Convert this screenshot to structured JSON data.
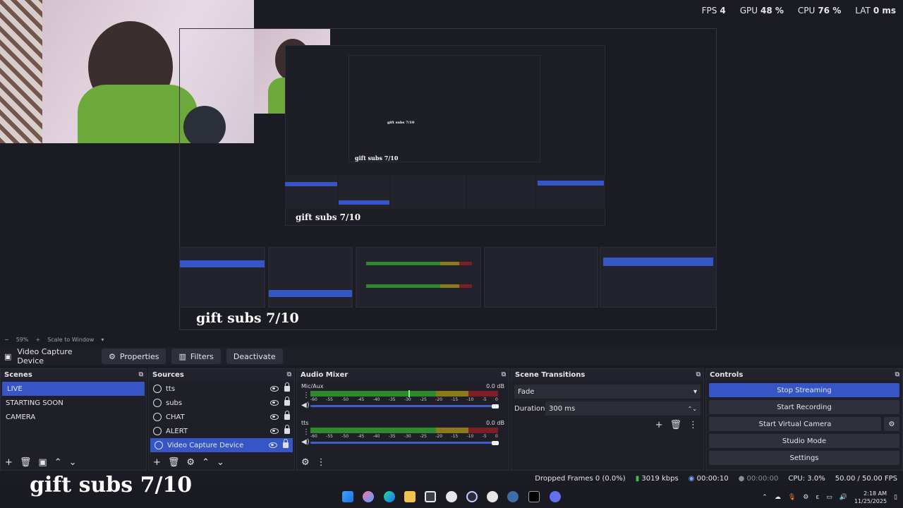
{
  "perf": {
    "fps_label": "FPS",
    "fps": "4",
    "gpu_label": "GPU",
    "gpu": "48 %",
    "cpu_label": "CPU",
    "cpu": "76 %",
    "lat_label": "LAT",
    "lat": "0 ms"
  },
  "preview": {
    "caption_lg": "gift subs 7/10",
    "caption_md": "gift subs 7/10",
    "caption_sm": "gift subs 7/10",
    "caption_xs": "gift subs 7/10"
  },
  "zoom": {
    "value": "59%",
    "label": "Scale to Window"
  },
  "context": {
    "title": "Video Capture Device",
    "properties": "Properties",
    "filters": "Filters",
    "deactivate": "Deactivate"
  },
  "scenes": {
    "title": "Scenes",
    "items": [
      "LIVE",
      "STARTING SOON",
      "CAMERA"
    ]
  },
  "sources": {
    "title": "Sources",
    "items": [
      "tts",
      "subs",
      "CHAT",
      "ALERT",
      "Video Capture Device"
    ]
  },
  "mixer": {
    "title": "Audio Mixer",
    "channels": [
      {
        "name": "Mic/Aux",
        "db": "0.0 dB"
      },
      {
        "name": "tts",
        "db": "0.0 dB"
      }
    ],
    "ticks": [
      "-60",
      "-55",
      "-50",
      "-45",
      "-40",
      "-35",
      "-30",
      "-25",
      "-20",
      "-15",
      "-10",
      "-5",
      "0"
    ]
  },
  "transitions": {
    "title": "Scene Transitions",
    "selected": "Fade",
    "duration_label": "Duration",
    "duration": "300 ms"
  },
  "controls": {
    "title": "Controls",
    "stop_streaming": "Stop Streaming",
    "start_recording": "Start Recording",
    "start_virtual_camera": "Start Virtual Camera",
    "studio_mode": "Studio Mode",
    "settings": "Settings"
  },
  "status": {
    "dropped": "Dropped Frames 0 (0.0%)",
    "bitrate": "3019 kbps",
    "stream_time": "00:00:10",
    "rec_time": "00:00:00",
    "cpu": "CPU: 3.0%",
    "fps": "50.00 / 50.00 FPS"
  },
  "caption": "gift subs 7/10",
  "clock": {
    "time": "2:18 AM",
    "date": "11/25/2025"
  },
  "colors": {
    "accent": "#3656c7",
    "meter_green": "#2f8a2f",
    "meter_yellow": "#8a7a1c",
    "meter_red": "#7a1f26"
  }
}
